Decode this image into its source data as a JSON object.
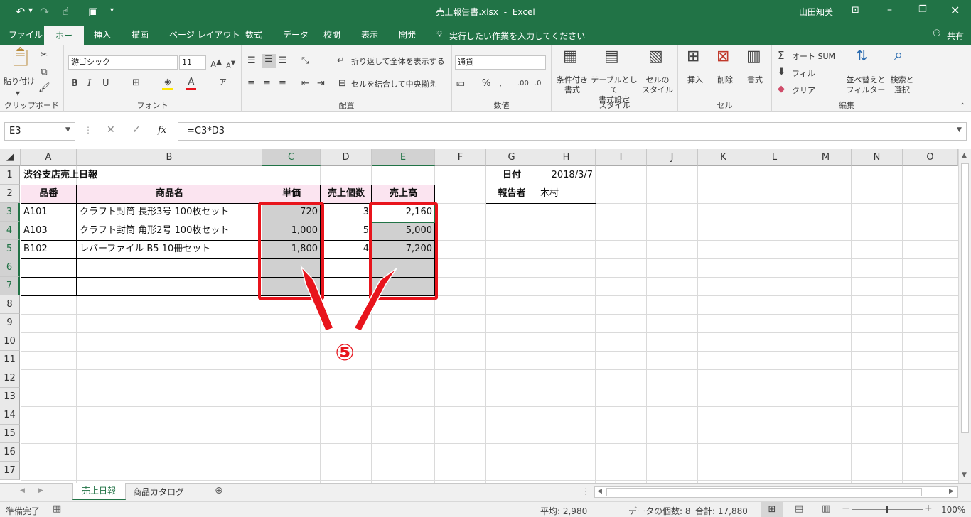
{
  "app": {
    "file_title": "売上報告書.xlsx",
    "separator": "-",
    "app_name": "Excel",
    "user": "山田知美"
  },
  "tabs": [
    "ファイル",
    "ホーム",
    "挿入",
    "描画",
    "ページ レイアウト",
    "数式",
    "データ",
    "校閲",
    "表示",
    "開発"
  ],
  "tell_me": "実行したい作業を入力してください",
  "share": "共有",
  "ribbon": {
    "clipboard": {
      "paste": "貼り付け",
      "label": "クリップボード"
    },
    "font": {
      "name": "游ゴシック",
      "size": "11",
      "label": "フォント"
    },
    "align": {
      "wrap": "折り返して全体を表示する",
      "merge": "セルを結合して中央揃え",
      "label": "配置"
    },
    "number": {
      "format": "通貨",
      "label": "数値"
    },
    "styles": {
      "cond1": "条件付き",
      "cond2": "書式",
      "table1": "テーブルとして",
      "table2": "書式設定",
      "cell1": "セルの",
      "cell2": "スタイル",
      "label": "スタイル"
    },
    "cells": {
      "insert": "挿入",
      "delete": "削除",
      "format": "書式",
      "label": "セル"
    },
    "editing": {
      "autosum": "オート SUM",
      "fill": "フィル",
      "clear": "クリア",
      "sort1": "並べ替えと",
      "sort2": "フィルター",
      "find1": "検索と",
      "find2": "選択",
      "label": "編集"
    }
  },
  "formula_bar": {
    "name_box": "E3",
    "formula": "=C3*D3"
  },
  "columns": [
    "A",
    "B",
    "C",
    "D",
    "E",
    "F",
    "G",
    "H",
    "I",
    "J",
    "K",
    "L",
    "M",
    "N",
    "O"
  ],
  "rows": [
    "1",
    "2",
    "3",
    "4",
    "5",
    "6",
    "7",
    "8",
    "9",
    "10",
    "11",
    "12",
    "13",
    "14",
    "15",
    "16",
    "17"
  ],
  "sheet": {
    "title": "渋谷支店売上日報",
    "headers": [
      "品番",
      "商品名",
      "単価",
      "売上個数",
      "売上高"
    ],
    "data": [
      [
        "A101",
        "クラフト封筒 長形3号 100枚セット",
        "720",
        "3",
        "2,160"
      ],
      [
        "A103",
        "クラフト封筒 角形2号 100枚セット",
        "1,000",
        "5",
        "5,000"
      ],
      [
        "B102",
        "レバーファイル B5 10冊セット",
        "1,800",
        "4",
        "7,200"
      ]
    ],
    "date_label": "日付",
    "date_value": "2018/3/7",
    "reporter_label": "報告者",
    "reporter_value": "木村"
  },
  "annotation": "⑤",
  "sheet_tabs": [
    "売上日報",
    "商品カタログ"
  ],
  "status": {
    "ready": "準備完了",
    "average": "平均: 2,980",
    "count": "データの個数: 8",
    "sum": "合計: 17,880",
    "zoom": "100%"
  },
  "colors": {
    "excel_green": "#217346",
    "highlight": "#e8141c",
    "header_fill": "#fbe4f0",
    "selected_fill": "#d0d0d0"
  }
}
